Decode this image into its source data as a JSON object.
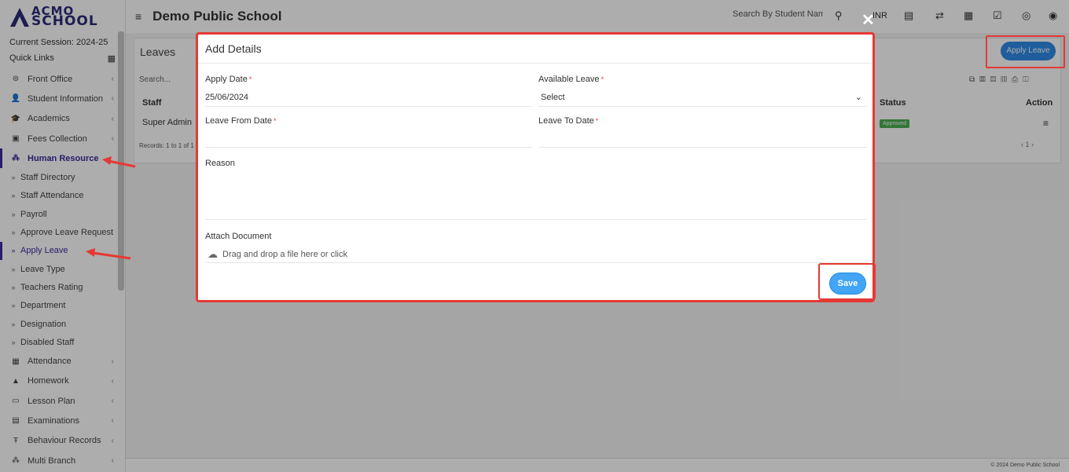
{
  "app": {
    "logo_line1": "ACMO",
    "logo_line2": "SCHOOL",
    "school_name": "Demo Public School",
    "session": "Current Session: 2024-25",
    "quick_links": "Quick Links"
  },
  "topbar": {
    "search_placeholder": "Search By Student Nam",
    "currency": "INR",
    "icons": [
      "menu-icon",
      "search-icon",
      "flag-icon",
      "swap-icon",
      "calendar-icon",
      "check-square-icon",
      "whatsapp-icon",
      "user-avatar-icon"
    ]
  },
  "sidebar": {
    "items": [
      {
        "label": "Front Office",
        "icon": "front-office-icon"
      },
      {
        "label": "Student Information",
        "icon": "student-icon"
      },
      {
        "label": "Academics",
        "icon": "academics-icon"
      },
      {
        "label": "Fees Collection",
        "icon": "fees-icon"
      },
      {
        "label": "Human Resource",
        "icon": "hr-icon"
      },
      {
        "label": "Staff Directory"
      },
      {
        "label": "Staff Attendance"
      },
      {
        "label": "Payroll"
      },
      {
        "label": "Approve Leave Request"
      },
      {
        "label": "Apply Leave"
      },
      {
        "label": "Leave Type"
      },
      {
        "label": "Teachers Rating"
      },
      {
        "label": "Department"
      },
      {
        "label": "Designation"
      },
      {
        "label": "Disabled Staff"
      },
      {
        "label": "Attendance",
        "icon": "attendance-icon"
      },
      {
        "label": "Homework",
        "icon": "homework-icon"
      },
      {
        "label": "Lesson Plan",
        "icon": "lesson-plan-icon"
      },
      {
        "label": "Examinations",
        "icon": "exam-icon"
      },
      {
        "label": "Behaviour Records",
        "icon": "behaviour-icon"
      },
      {
        "label": "Multi Branch",
        "icon": "branch-icon"
      }
    ]
  },
  "page": {
    "title": "Leaves",
    "search_placeholder": "Search...",
    "apply_leave_button": "Apply Leave",
    "table": {
      "headers": {
        "staff": "Staff",
        "status": "Status",
        "action": "Action"
      },
      "rows": [
        {
          "staff": "Super Admin",
          "status": "Approved"
        }
      ],
      "records": "Records: 1 to 1 of 1",
      "page": "1"
    }
  },
  "modal": {
    "title": "Add Details",
    "apply_date_label": "Apply Date",
    "apply_date_value": "25/06/2024",
    "available_leave_label": "Available Leave",
    "available_leave_value": "Select",
    "leave_from_label": "Leave From Date",
    "leave_to_label": "Leave To Date",
    "reason_label": "Reason",
    "attach_label": "Attach Document",
    "attach_placeholder": "Drag and drop a file here or click",
    "save_button": "Save"
  },
  "footer": {
    "copyright": "© 2024 Demo Public School"
  },
  "colors": {
    "brand": "#2d2b7a",
    "primary_button": "#42a5f5",
    "highlight": "#e53935",
    "approved": "#4caf50"
  }
}
